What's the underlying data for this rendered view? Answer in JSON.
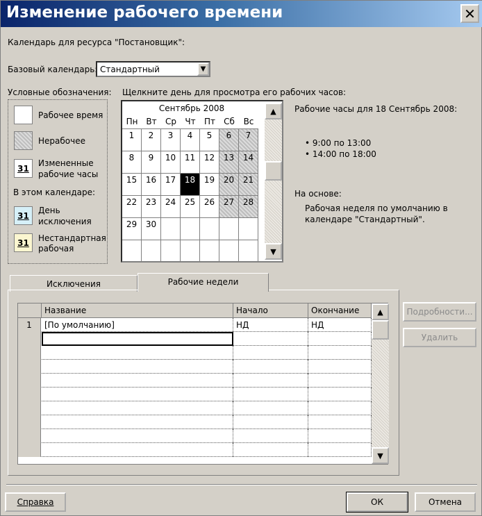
{
  "window": {
    "title": "Изменение рабочего времени",
    "close_icon": "close-icon"
  },
  "resource_label": "Календарь для ресурса \"Постановщик\":",
  "base_calendar": {
    "label": "Базовый календарь:",
    "value": "Стандартный"
  },
  "legend": {
    "title": "Условные обозначения:",
    "working": "Рабочее время",
    "nonworking": "Нерабочее",
    "changed_line1": "Измененные",
    "changed_line2": "рабочие часы",
    "in_this_calendar": "В этом календаре:",
    "exception_line1": "День",
    "exception_line2": "исключения",
    "nonstd_line1": "Нестандартная",
    "nonstd_line2": "рабочая",
    "swatch_number": "31"
  },
  "calendar": {
    "prompt": "Щелкните день для просмотра его рабочих часов:",
    "month": "Сентябрь 2008",
    "weekdays": [
      "Пн",
      "Вт",
      "Ср",
      "Чт",
      "Пт",
      "Сб",
      "Вс"
    ],
    "weeks": [
      [
        "1",
        "2",
        "3",
        "4",
        "5",
        "6",
        "7"
      ],
      [
        "8",
        "9",
        "10",
        "11",
        "12",
        "13",
        "14"
      ],
      [
        "15",
        "16",
        "17",
        "18",
        "19",
        "20",
        "21"
      ],
      [
        "22",
        "23",
        "24",
        "25",
        "26",
        "27",
        "28"
      ],
      [
        "29",
        "30",
        "",
        "",
        "",
        "",
        ""
      ],
      [
        "",
        "",
        "",
        "",
        "",
        "",
        ""
      ]
    ],
    "selected_day": "18"
  },
  "working_hours": {
    "title": "Рабочие часы для 18 Сентябрь 2008:",
    "items": [
      "9:00 по 13:00",
      "14:00 по 18:00"
    ],
    "based_on_label": "На основе:",
    "based_on_line1": "Рабочая неделя по умолчанию в",
    "based_on_line2": "календаре \"Стандартный\"."
  },
  "tabs": {
    "exceptions": "Исключения",
    "work_weeks": "Рабочие недели"
  },
  "table": {
    "headers": {
      "name": "Название",
      "start": "Начало",
      "finish": "Окончание"
    },
    "rows": [
      {
        "num": "1",
        "name": "[По умолчанию]",
        "start": "НД",
        "finish": "НД"
      }
    ]
  },
  "buttons": {
    "details": "Подробности...",
    "delete": "Удалить",
    "help": "Справка",
    "ok": "ОК",
    "cancel": "Отмена"
  },
  "colors": {
    "title_start": "#0a246a",
    "title_end": "#a6caf0",
    "dialog_bg": "#d4d0c8",
    "exception": "#d6f0f8",
    "nonstandard": "#fbf6d0"
  }
}
